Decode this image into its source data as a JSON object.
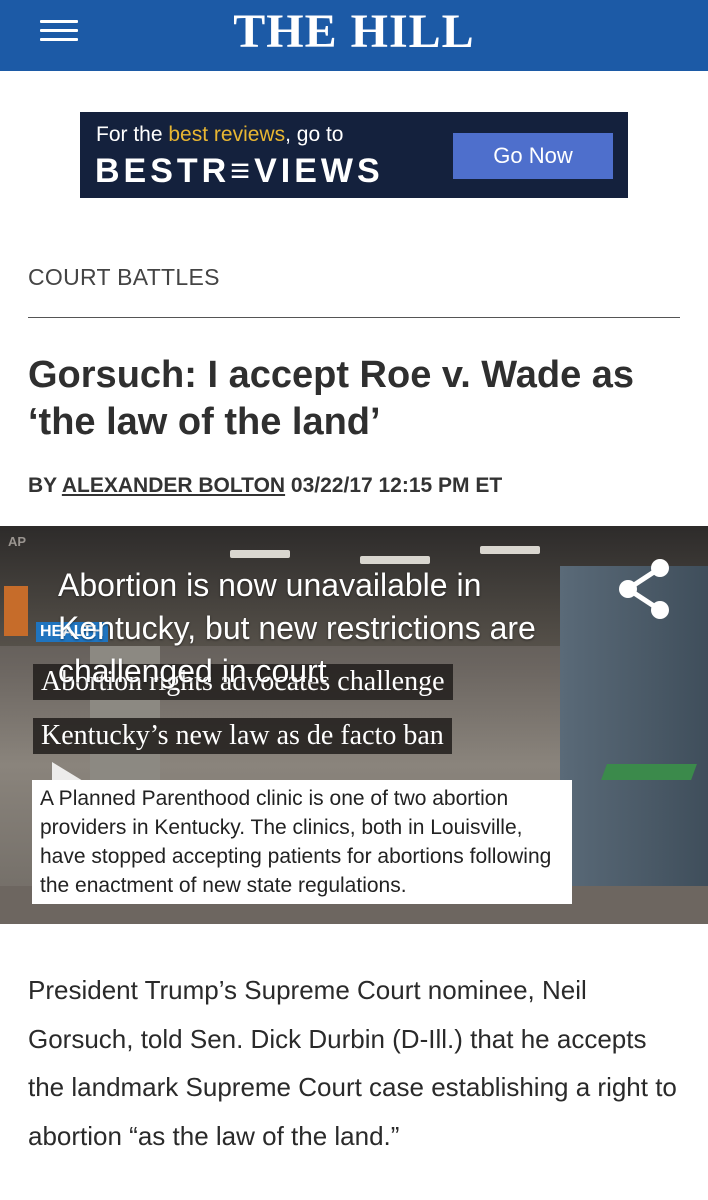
{
  "header": {
    "logo": "THE HILL",
    "menu_icon": "hamburger-menu-icon",
    "background": "#1c5aa6"
  },
  "ad": {
    "line1_prefix": "For the ",
    "line1_highlight": "best reviews",
    "line1_suffix": ", go to",
    "brand": "BESTR≡VIEWS",
    "button": "Go Now"
  },
  "article": {
    "section": "COURT BATTLES",
    "headline": "Gorsuch: I accept Roe v. Wade as ‘the law of the land’",
    "byline_prefix": "BY ",
    "author": "ALEXANDER BOLTON",
    "timestamp": " 03/22/17 12:15 PM ET",
    "body": "President Trump’s Supreme Court nominee, Neil Gorsuch, told Sen. Dick Durbin (D-Ill.) that he accepts the landmark Supreme Court case establishing a right to abortion “as the law of the land.”"
  },
  "video": {
    "watermark": "AP",
    "title": "Abortion is now unavailable in Kentucky, but new restrictions are challenged in court",
    "tag": "HEALTH",
    "chyron1": "Abortion rights advocates challenge",
    "chyron2": "Kentucky’s new law as de facto ban",
    "caption": "A Planned Parenthood clinic is one of two abortion providers in Kentucky. The clinics, both in Louisville, have stopped accepting patients for abortions following the enactment of new state regulations.",
    "share_icon": "share-icon",
    "play_icon": "play-icon"
  }
}
